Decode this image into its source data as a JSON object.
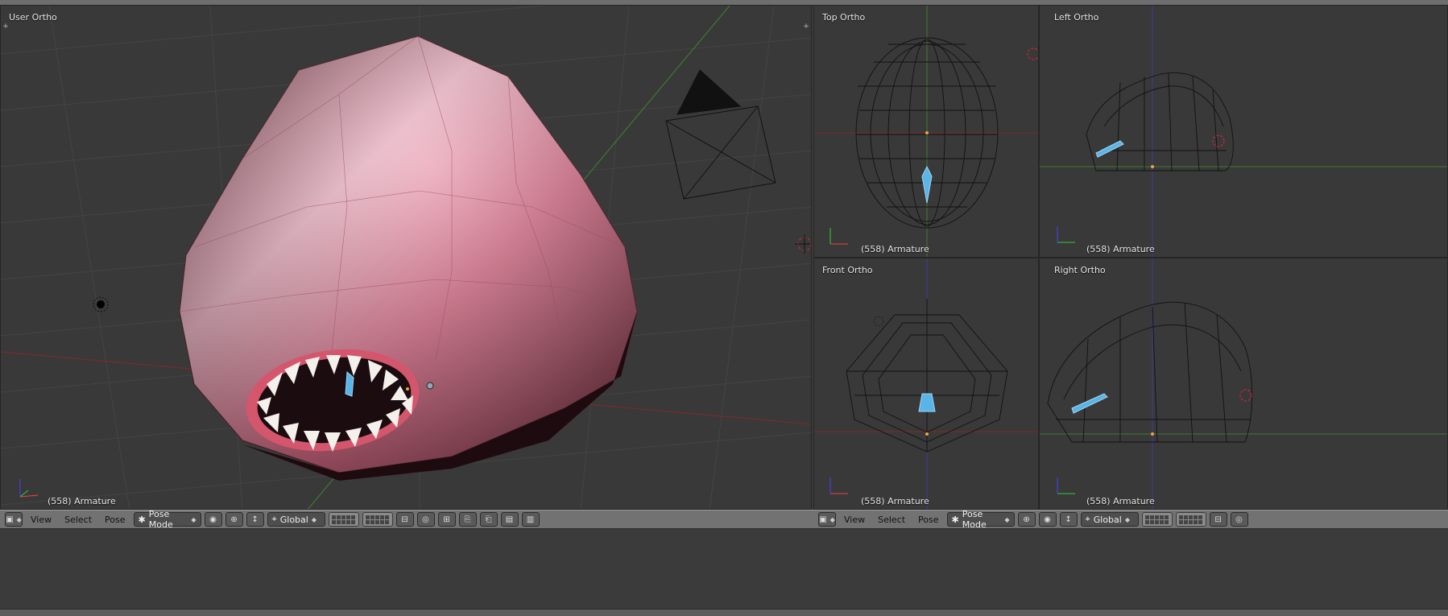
{
  "viewports": {
    "main": {
      "label": "User Ortho",
      "status": "(558) Armature"
    },
    "top": {
      "label": "Top Ortho",
      "status": "(558) Armature"
    },
    "left": {
      "label": "Left Ortho",
      "status": "(558) Armature"
    },
    "front": {
      "label": "Front Ortho",
      "status": "(558) Armature"
    },
    "right": {
      "label": "Right Ortho",
      "status": "(558) Armature"
    }
  },
  "header_left": {
    "menu_view": "View",
    "menu_select": "Select",
    "menu_pose": "Pose",
    "mode": "Pose Mode",
    "orientation": "Global"
  },
  "header_right": {
    "menu_view": "View",
    "menu_select": "Select",
    "menu_pose": "Pose",
    "mode": "Pose Mode",
    "orientation": "Global"
  },
  "colors": {
    "viewport_bg": "#393939",
    "header_bg": "#727272",
    "mesh_pink": "#d86b86",
    "bone_blue": "#5ab4e6",
    "axis_x": "#c0392b",
    "axis_y": "#3bb53b",
    "axis_z": "#3a5fd8"
  },
  "icons": [
    "3d-view-icon",
    "pose-mode-icon",
    "pivot-icon",
    "manipulator-icon",
    "layers-grid",
    "snap-icon",
    "render-icon",
    "camera-icon",
    "light-icon",
    "3d-cursor-icon"
  ]
}
